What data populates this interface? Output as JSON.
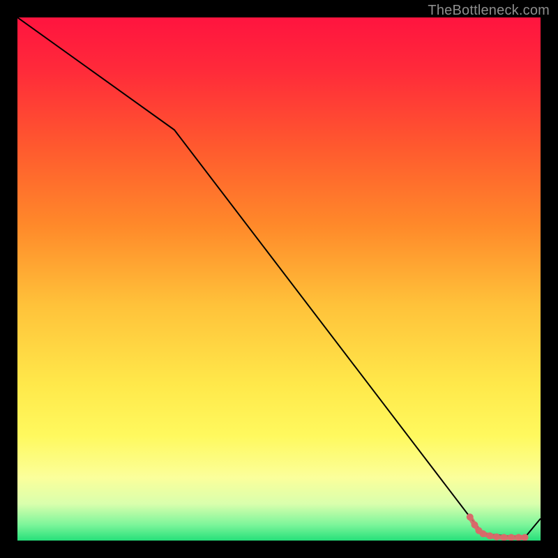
{
  "branding": "TheBottleneck.com",
  "chart_data": {
    "type": "line",
    "title": "",
    "xlabel": "",
    "ylabel": "",
    "xlim": [
      0,
      100
    ],
    "ylim": [
      0,
      100
    ],
    "series": [
      {
        "name": "curve",
        "x": [
          0,
          30,
          86.5,
          89,
          97,
          100
        ],
        "values": [
          100,
          78.5,
          4.5,
          1.3,
          0.6,
          4.2
        ]
      }
    ],
    "markers": {
      "name": "bottom-cluster",
      "points": [
        {
          "x": 86.5,
          "y": 4.5
        },
        {
          "x": 87.4,
          "y": 3.0
        },
        {
          "x": 88.2,
          "y": 1.9
        },
        {
          "x": 89.0,
          "y": 1.3
        },
        {
          "x": 90.3,
          "y": 0.9
        },
        {
          "x": 91.6,
          "y": 0.7
        },
        {
          "x": 93.0,
          "y": 0.6
        },
        {
          "x": 94.4,
          "y": 0.6
        },
        {
          "x": 95.8,
          "y": 0.6
        },
        {
          "x": 97.0,
          "y": 0.6
        }
      ]
    },
    "gradient_stops": [
      {
        "offset": 0.0,
        "color": "#ff143f"
      },
      {
        "offset": 0.1,
        "color": "#ff2a3a"
      },
      {
        "offset": 0.25,
        "color": "#ff5a2e"
      },
      {
        "offset": 0.4,
        "color": "#ff8a2a"
      },
      {
        "offset": 0.55,
        "color": "#ffc23a"
      },
      {
        "offset": 0.7,
        "color": "#ffe84a"
      },
      {
        "offset": 0.8,
        "color": "#fff95e"
      },
      {
        "offset": 0.88,
        "color": "#fbff9b"
      },
      {
        "offset": 0.93,
        "color": "#d9ffad"
      },
      {
        "offset": 0.97,
        "color": "#7cf59a"
      },
      {
        "offset": 1.0,
        "color": "#26e07a"
      }
    ],
    "marker_color": "#d86a6a"
  }
}
